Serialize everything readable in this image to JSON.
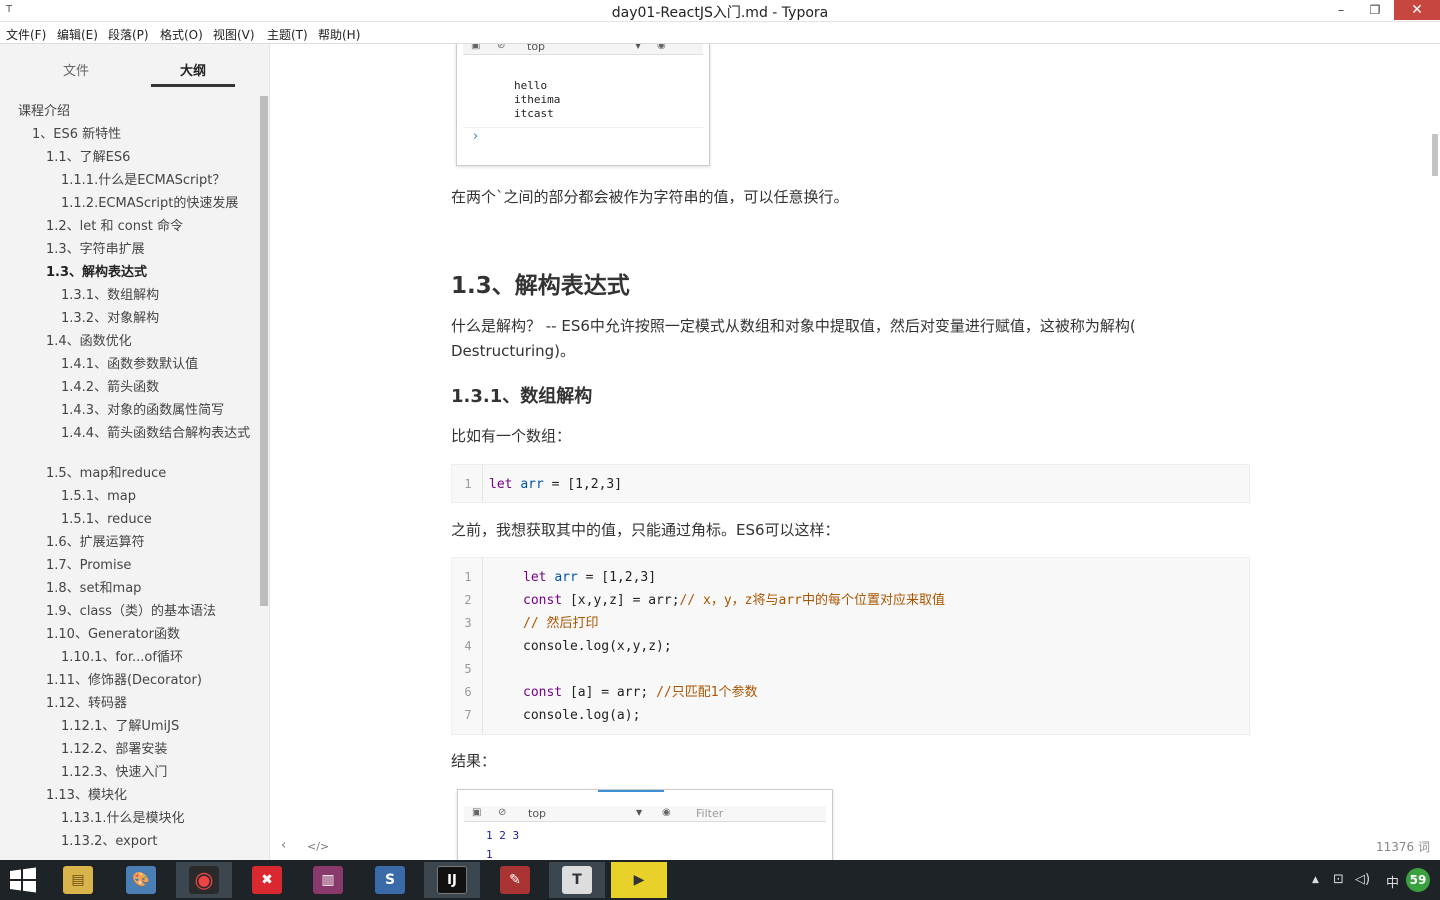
{
  "window": {
    "app_icon": "T",
    "title": "day01-ReactJS入门.md - Typora",
    "minimize": "–",
    "restore": "❐",
    "close": "✕"
  },
  "menu": [
    "文件(F)",
    "编辑(E)",
    "段落(P)",
    "格式(O)",
    "视图(V)",
    "主题(T)",
    "帮助(H)"
  ],
  "sidebar": {
    "tabs": [
      "文件",
      "大纲"
    ],
    "active_tab": "大纲",
    "outline": [
      "课程介绍",
      "1、ES6 新特性",
      "1.1、了解ES6",
      "1.1.1.什么是ECMAScript？",
      "1.1.2.ECMAScript的快速发展",
      "1.2、let 和 const 命令",
      "1.3、字符串扩展",
      "1.3、解构表达式",
      "1.3.1、数组解构",
      "1.3.2、对象解构",
      "1.4、函数优化",
      "1.4.1、函数参数默认值",
      "1.4.2、箭头函数",
      "1.4.3、对象的函数属性简写",
      "1.4.4、箭头函数结合解构表达式",
      "1.5、map和reduce",
      "1.5.1、map",
      "1.5.1、reduce",
      "1.6、扩展运算符",
      "1.7、Promise",
      "1.8、set和map",
      "1.9、class（类）的基本语法",
      "1.10、Generator函数",
      "1.10.1、for...of循环",
      "1.11、修饰器(Decorator)",
      "1.12、转码器",
      "1.12.1、了解UmiJS",
      "1.12.2、部署安装",
      "1.12.3、快速入门",
      "1.13、模块化",
      "1.13.1.什么是模块化",
      "1.13.2、export"
    ]
  },
  "console_top": {
    "context": "top",
    "lines": [
      "hello",
      "itheima",
      "itcast"
    ],
    "prompt": "›"
  },
  "doc": {
    "p_template": "在两个`之间的部分都会被作为字符串的值，可以任意换行。",
    "h_destructure": "1.3、解构表达式",
    "p_what_1": "什么是解构？ -- ES6中允许按照一定模式从数组和对象中提取值，然后对变量进行赋值，这被称为解构(",
    "p_what_2": "Destructuring)。",
    "h_array": "1.3.1、数组解构",
    "p_example": "比如有一个数组：",
    "code1": [
      {
        "n": "1",
        "kw": "let",
        "var": "arr",
        "rest": " = [1,2,3]"
      }
    ],
    "p_before": "之前，我想获取其中的值，只能通过角标。ES6可以这样：",
    "code2": [
      {
        "n": "1",
        "kw": "let",
        "var": "arr",
        "rest": " = [1,2,3]",
        "cm": ""
      },
      {
        "n": "2",
        "kw": "const",
        "var": "",
        "rest": " [x,y,z] = arr;",
        "cm": "// x，y，z将与arr中的每个位置对应来取值"
      },
      {
        "n": "3",
        "kw": "",
        "var": "",
        "rest": "",
        "cm": "// 然后打印"
      },
      {
        "n": "4",
        "kw": "",
        "var": "",
        "rest": "console.log(x,y,z);",
        "cm": ""
      },
      {
        "n": "5",
        "kw": "",
        "var": "",
        "rest": "",
        "cm": ""
      },
      {
        "n": "6",
        "kw": "const",
        "var": "",
        "rest": " [a] = arr; ",
        "cm": "//只匹配1个参数"
      },
      {
        "n": "7",
        "kw": "",
        "var": "",
        "rest": "console.log(a);",
        "cm": ""
      }
    ],
    "p_result": "结果："
  },
  "console_bottom": {
    "context": "top",
    "filter_placeholder": "Filter",
    "lines": [
      "1 2 3",
      "1"
    ]
  },
  "footer": {
    "back": "‹",
    "source": "</>",
    "word_count": "11376 词"
  },
  "taskbar": {
    "apps": [
      {
        "name": "explorer",
        "label": "▤",
        "color": "#d9b44a"
      },
      {
        "name": "paint",
        "label": "🎨",
        "color": "#4a7fb5"
      },
      {
        "name": "chrome",
        "label": "◉",
        "color": "#2a2a2a"
      },
      {
        "name": "xmind",
        "label": "✖",
        "color": "#d9282f"
      },
      {
        "name": "winrar",
        "label": "▥",
        "color": "#8a3a6a"
      },
      {
        "name": "sublime",
        "label": "S",
        "color": "#3a6aa8"
      },
      {
        "name": "intellij",
        "label": "IJ",
        "color": "#111111"
      },
      {
        "name": "notepad",
        "label": "✎",
        "color": "#a33"
      },
      {
        "name": "typora",
        "label": "T",
        "color": "#dddddd"
      },
      {
        "name": "player",
        "label": "▶",
        "color": "#e8d22a"
      }
    ],
    "tray": {
      "arrow": "▲",
      "network": "⊡",
      "volume": "◁)",
      "ime": "中",
      "badge": "59"
    }
  }
}
